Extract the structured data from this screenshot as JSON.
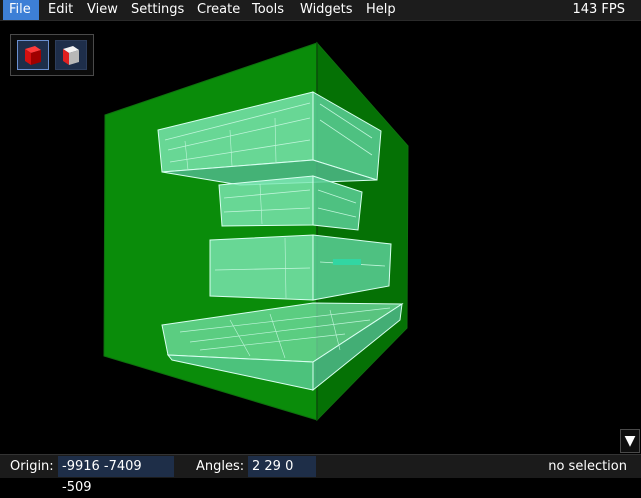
{
  "menu": {
    "items": [
      {
        "label": "File"
      },
      {
        "label": "Edit"
      },
      {
        "label": "View"
      },
      {
        "label": "Settings"
      },
      {
        "label": "Create"
      },
      {
        "label": "Tools"
      },
      {
        "label": "Widgets"
      },
      {
        "label": "Help"
      }
    ],
    "active": "File"
  },
  "fps": "143 FPS",
  "viewport": {
    "toolbar": {
      "buttons": [
        {
          "icon": "solid-cube-icon"
        },
        {
          "icon": "mixed-cube-icon"
        }
      ]
    },
    "dropdown_icon": "▼",
    "colors": {
      "background": "#000000",
      "volume": "#0a8c0a",
      "brush": "#7ee8b4"
    }
  },
  "status": {
    "origin_label": "Origin:",
    "origin_value": "-9916 -7409 -509",
    "angles_label": "Angles:",
    "angles_value": "2 29 0",
    "selection": "no selection"
  }
}
